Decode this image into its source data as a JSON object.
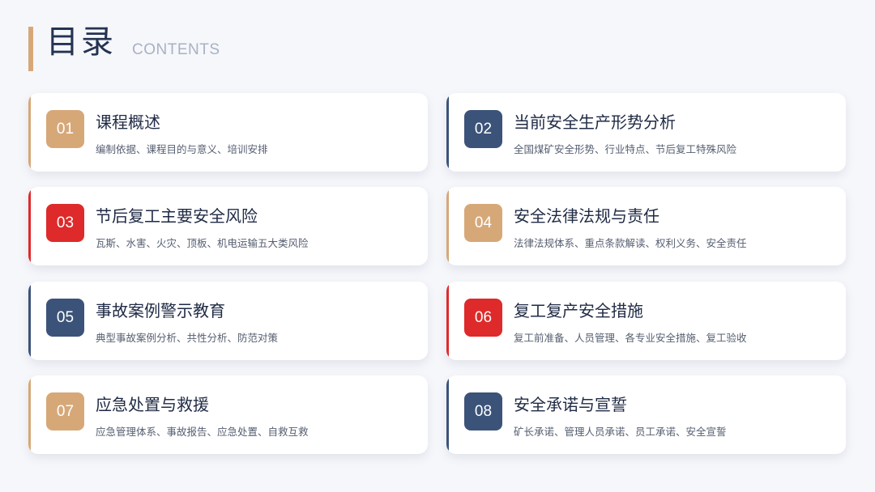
{
  "header": {
    "title": "目录",
    "subtitle": "CONTENTS"
  },
  "colors": {
    "gold": "#d6a878",
    "navy": "#3c5379",
    "red": "#de2a2a",
    "background": "#f6f7fb"
  },
  "items": [
    {
      "num": "01",
      "title": "课程概述",
      "desc": "编制依据、课程目的与意义、培训安排",
      "color": "gold"
    },
    {
      "num": "02",
      "title": "当前安全生产形势分析",
      "desc": "全国煤矿安全形势、行业特点、节后复工特殊风险",
      "color": "navy"
    },
    {
      "num": "03",
      "title": "节后复工主要安全风险",
      "desc": "瓦斯、水害、火灾、顶板、机电运输五大类风险",
      "color": "red"
    },
    {
      "num": "04",
      "title": "安全法律法规与责任",
      "desc": "法律法规体系、重点条款解读、权利义务、安全责任",
      "color": "gold"
    },
    {
      "num": "05",
      "title": "事故案例警示教育",
      "desc": "典型事故案例分析、共性分析、防范对策",
      "color": "navy"
    },
    {
      "num": "06",
      "title": "复工复产安全措施",
      "desc": "复工前准备、人员管理、各专业安全措施、复工验收",
      "color": "red"
    },
    {
      "num": "07",
      "title": "应急处置与救援",
      "desc": "应急管理体系、事故报告、应急处置、自救互救",
      "color": "gold"
    },
    {
      "num": "08",
      "title": "安全承诺与宣誓",
      "desc": "矿长承诺、管理人员承诺、员工承诺、安全宣誓",
      "color": "navy"
    }
  ]
}
